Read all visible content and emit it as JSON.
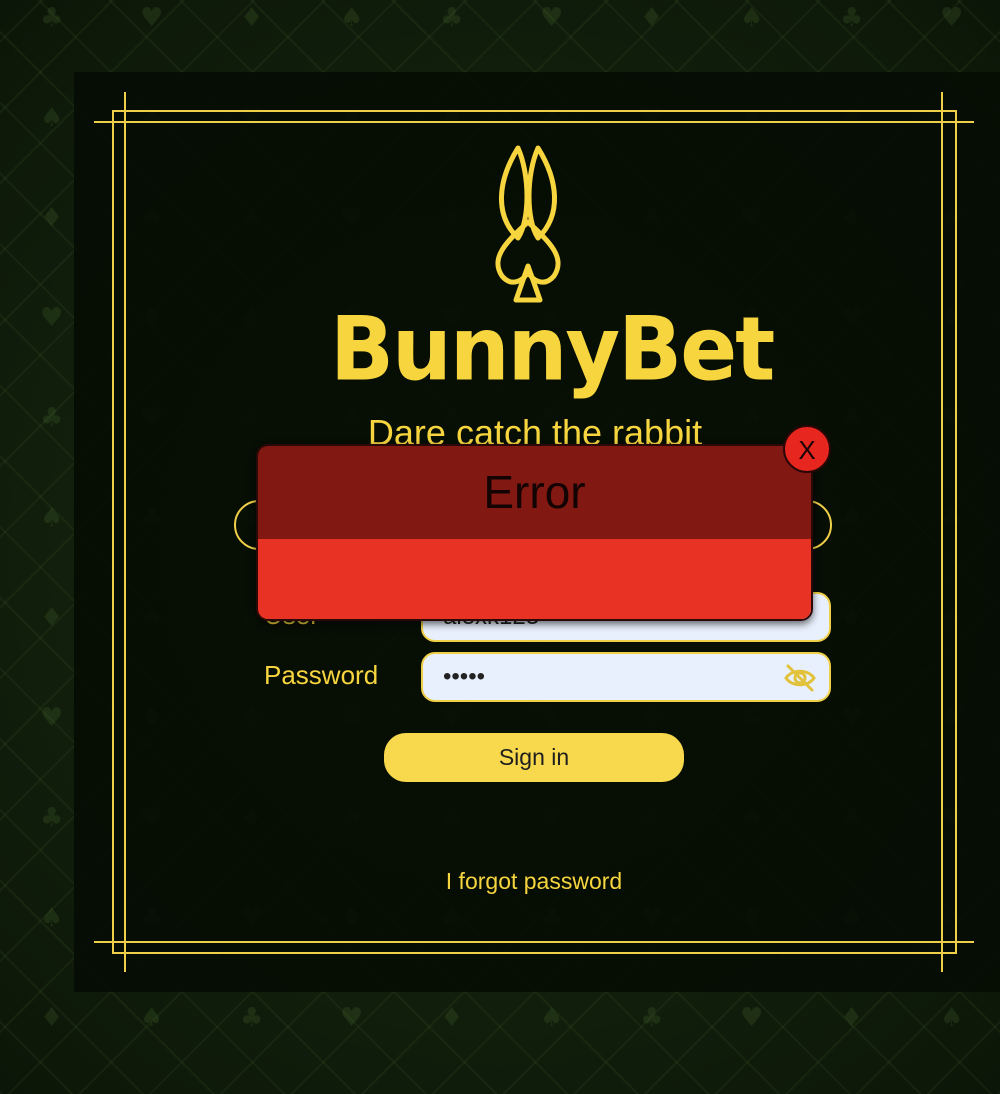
{
  "brand": {
    "name": "BunnyBet",
    "tagline": "Dare catch the rabbit"
  },
  "login": {
    "user_label": "User",
    "user_value": "alexk123",
    "password_label": "Password",
    "password_value": "•••••",
    "sign_in_label": "Sign in",
    "forgot_label": "I forgot password"
  },
  "error_modal": {
    "title": "Error",
    "message": "",
    "close_label": "X"
  },
  "icons": {
    "logo": "bunny-spade-icon",
    "password_toggle": "eye-slash-icon",
    "background": "card-suits-pattern"
  },
  "colors": {
    "accent_gold": "#f6d53f",
    "modal_header": "#811812",
    "modal_body": "#e83223",
    "input_bg": "#e9f0fd"
  }
}
